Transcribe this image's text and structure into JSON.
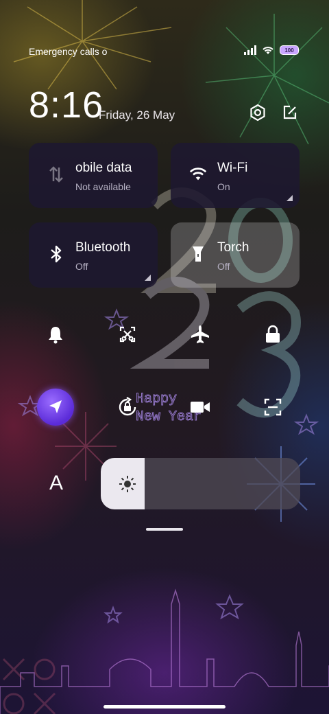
{
  "status_bar": {
    "carrier_text": "Emergency calls o",
    "signal_icon": "signal-icon",
    "wifi_icon": "wifi-icon",
    "battery_level": "100"
  },
  "clock": {
    "time": "8:16",
    "date": "Friday, 26 May"
  },
  "header_actions": [
    {
      "icon": "settings-icon"
    },
    {
      "icon": "edit-icon"
    }
  ],
  "tiles": {
    "mobile_data": {
      "label": "obile data",
      "state": "Not available",
      "icon": "mobile-data-icon"
    },
    "wifi": {
      "label": "Wi-Fi",
      "state": "On",
      "icon": "wifi-icon"
    },
    "bluetooth": {
      "label": "Bluetooth",
      "state": "Off",
      "icon": "bluetooth-icon"
    },
    "torch": {
      "label": "Torch",
      "state": "Off",
      "icon": "torch-icon"
    }
  },
  "quick_toggles": [
    {
      "icon": "bell-icon",
      "active": false
    },
    {
      "icon": "screenshot-icon",
      "active": false
    },
    {
      "icon": "airplane-icon",
      "active": false
    },
    {
      "icon": "lock-icon",
      "active": false
    },
    {
      "icon": "location-icon",
      "active": true
    },
    {
      "icon": "auto-rotate-icon",
      "active": false
    },
    {
      "icon": "video-camera-icon",
      "active": false
    },
    {
      "icon": "scan-icon",
      "active": false
    }
  ],
  "font_button": {
    "label": "A"
  },
  "brightness": {
    "level": 0.22,
    "icon": "sun-icon"
  },
  "wallpaper": {
    "line1": "Happy",
    "line2": "New Year"
  },
  "colors": {
    "accent": "#6a3ae6",
    "tile_dark": "#1e1830",
    "fill": "#ebe8ef"
  }
}
